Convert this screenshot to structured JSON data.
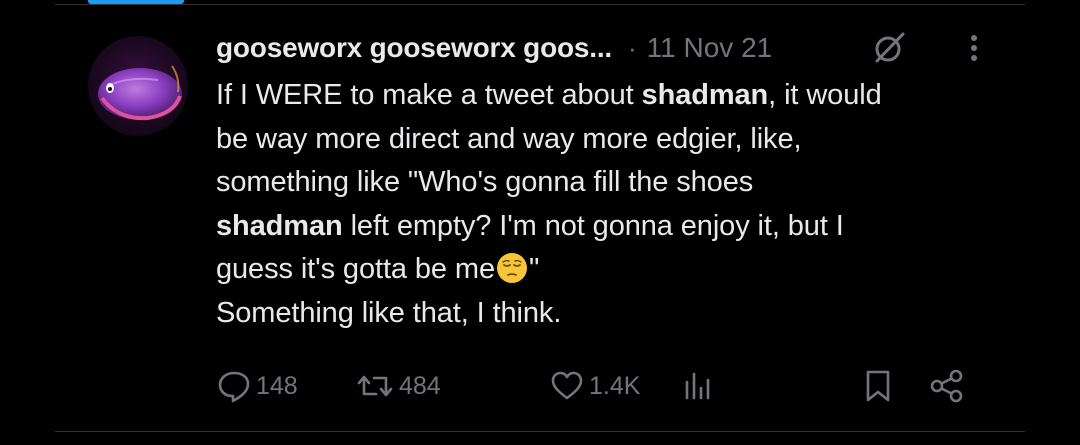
{
  "tweet": {
    "author_display": "gooseworx gooseworx goos...",
    "separator": "·",
    "date": "11 Nov 21",
    "text_lines": [
      [
        "If I WERE to make a tweet about ",
        "shadman",
        ", it would"
      ],
      [
        "be way more direct and way more edgier, like,"
      ],
      [
        "something like \"Who's gonna fill the shoes"
      ],
      [
        "shadman",
        " left empty? I'm not gonna enjoy it, but I"
      ],
      [
        "guess it's gotta be me",
        "\""
      ],
      [
        "Something like that, I think."
      ]
    ],
    "emoji": "pensive-face"
  },
  "actions": {
    "replies": "148",
    "reposts": "484",
    "likes": "1.4K",
    "views": "",
    "bookmark_icon": "bookmark-icon",
    "share_icon": "share-icon"
  },
  "colors": {
    "background": "#000000",
    "text_primary": "#e7e9ea",
    "text_secondary": "#71767b",
    "divider": "#2f3336",
    "accent": "#1d9bf0"
  }
}
